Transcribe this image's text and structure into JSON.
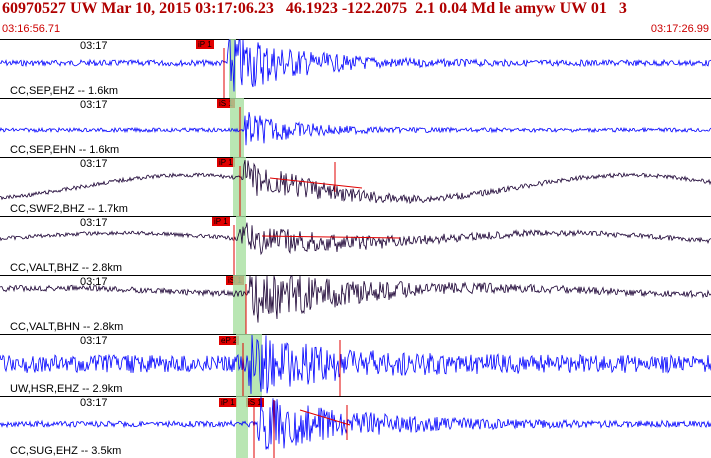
{
  "header": {
    "title": "60970527 UW Mar 10, 2015 03:17:06.23   46.1923 -122.2075  2.1 0.04 Md le amyw UW 01   3",
    "time_start": "03:16:56.71",
    "time_end": "03:17:26.99",
    "title_color": "#b00000",
    "time_color": "#cc0000"
  },
  "colors": {
    "blue_trace": "#0000ff",
    "dark_trace": "#1a0033",
    "pick_red": "#e00000",
    "window_green": "#a8e0a0"
  },
  "panels": [
    {
      "time": "03:17",
      "label": "CC,SEP,EHZ -- 1.6km",
      "color": "blue",
      "picks": [
        "iP 1"
      ]
    },
    {
      "time": "03:17",
      "label": "CC,SEP,EHN -- 1.6km",
      "color": "blue",
      "picks": [
        "iS 1"
      ]
    },
    {
      "time": "03:17",
      "label": "CC,SWF2,BHZ -- 1.7km",
      "color": "dark",
      "picks": [
        "iP 1"
      ]
    },
    {
      "time": "03:17",
      "label": "CC,VALT,BHZ -- 2.8km",
      "color": "dark",
      "picks": [
        "iP 1"
      ]
    },
    {
      "time": "03:17",
      "label": "CC,VALT,BHN -- 2.8km",
      "color": "dark",
      "picks": [
        "iS 1"
      ]
    },
    {
      "time": "03:17",
      "label": "UW,HSR,EHZ -- 2.9km",
      "color": "blue",
      "picks": [
        "eP 2"
      ]
    },
    {
      "time": "03:17",
      "label": "CC,SUG,EHZ -- 3.5km",
      "color": "blue",
      "picks": [
        "iP 1",
        "iS 1"
      ]
    }
  ]
}
